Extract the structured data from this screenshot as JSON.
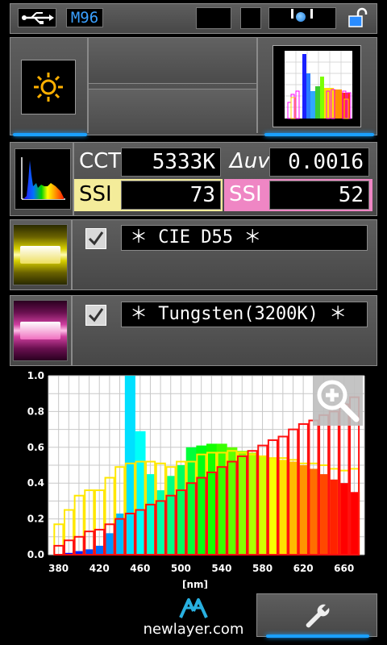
{
  "status_bar": {
    "usb_icon": "usb-icon",
    "model": "M96",
    "lock_icon": "unlock-icon"
  },
  "top_panel": {
    "mode_icon": "sun-icon"
  },
  "metrics": {
    "cct_label": "CCT",
    "cct_value": "5333K",
    "duv_label": "Δuv",
    "duv_value": "0.0016",
    "ssi_label_1": "SSI",
    "ssi_value_1": "73",
    "ssi_label_2": "SSI",
    "ssi_value_2": "52"
  },
  "references": [
    {
      "checked": true,
      "name": "＊ CIE D55 ＊",
      "color": "yellow"
    },
    {
      "checked": true,
      "name": "＊ Tungsten(3200K) ＊",
      "color": "magenta"
    }
  ],
  "colors": {
    "ssi1_bg": "#f4ec9a",
    "ssi2_bg": "#ef86c4",
    "accent": "#1aa0ff"
  },
  "chart_data": {
    "type": "bar",
    "xlabel": "[nm]",
    "ylabel": "",
    "xlim": [
      370,
      680
    ],
    "ylim": [
      0,
      1.0
    ],
    "xticks": [
      "380",
      "420",
      "460",
      "500",
      "540",
      "580",
      "620",
      "660"
    ],
    "yticks": [
      "0.0",
      "0.2",
      "0.4",
      "0.6",
      "0.8",
      "1.0"
    ],
    "grid": true,
    "x": [
      380,
      390,
      400,
      410,
      420,
      430,
      440,
      450,
      460,
      470,
      480,
      490,
      500,
      510,
      520,
      530,
      540,
      550,
      560,
      570,
      580,
      590,
      600,
      610,
      620,
      630,
      640,
      650,
      660,
      670
    ],
    "series": [
      {
        "name": "",
        "style": "filled-spectral",
        "values": [
          0.0,
          0.01,
          0.02,
          0.03,
          0.05,
          0.12,
          0.23,
          1.0,
          0.69,
          0.45,
          0.36,
          0.44,
          0.5,
          0.6,
          0.61,
          0.62,
          0.62,
          0.6,
          0.58,
          0.57,
          0.55,
          0.54,
          0.53,
          0.52,
          0.5,
          0.48,
          0.45,
          0.42,
          0.4,
          0.35
        ]
      },
      {
        "name": "",
        "style": "outline-yellow",
        "values": [
          0.17,
          0.25,
          0.33,
          0.36,
          0.36,
          0.43,
          0.49,
          0.51,
          0.52,
          0.52,
          0.51,
          0.49,
          0.52,
          0.52,
          0.56,
          0.57,
          0.57,
          0.58,
          0.57,
          0.56,
          0.55,
          0.54,
          0.54,
          0.53,
          0.51,
          0.51,
          0.5,
          0.48,
          0.47,
          0.48
        ]
      },
      {
        "name": "",
        "style": "outline-red",
        "values": [
          0.05,
          0.08,
          0.1,
          0.13,
          0.14,
          0.17,
          0.2,
          0.23,
          0.25,
          0.28,
          0.3,
          0.33,
          0.36,
          0.4,
          0.43,
          0.46,
          0.49,
          0.52,
          0.55,
          0.58,
          0.61,
          0.64,
          0.66,
          0.7,
          0.73,
          0.75,
          0.78,
          0.8,
          0.84,
          0.88
        ]
      }
    ]
  },
  "bottom": {
    "brand": "newlayer.com",
    "settings_icon": "wrench-icon",
    "zoom_icon": "zoom-in-icon"
  }
}
